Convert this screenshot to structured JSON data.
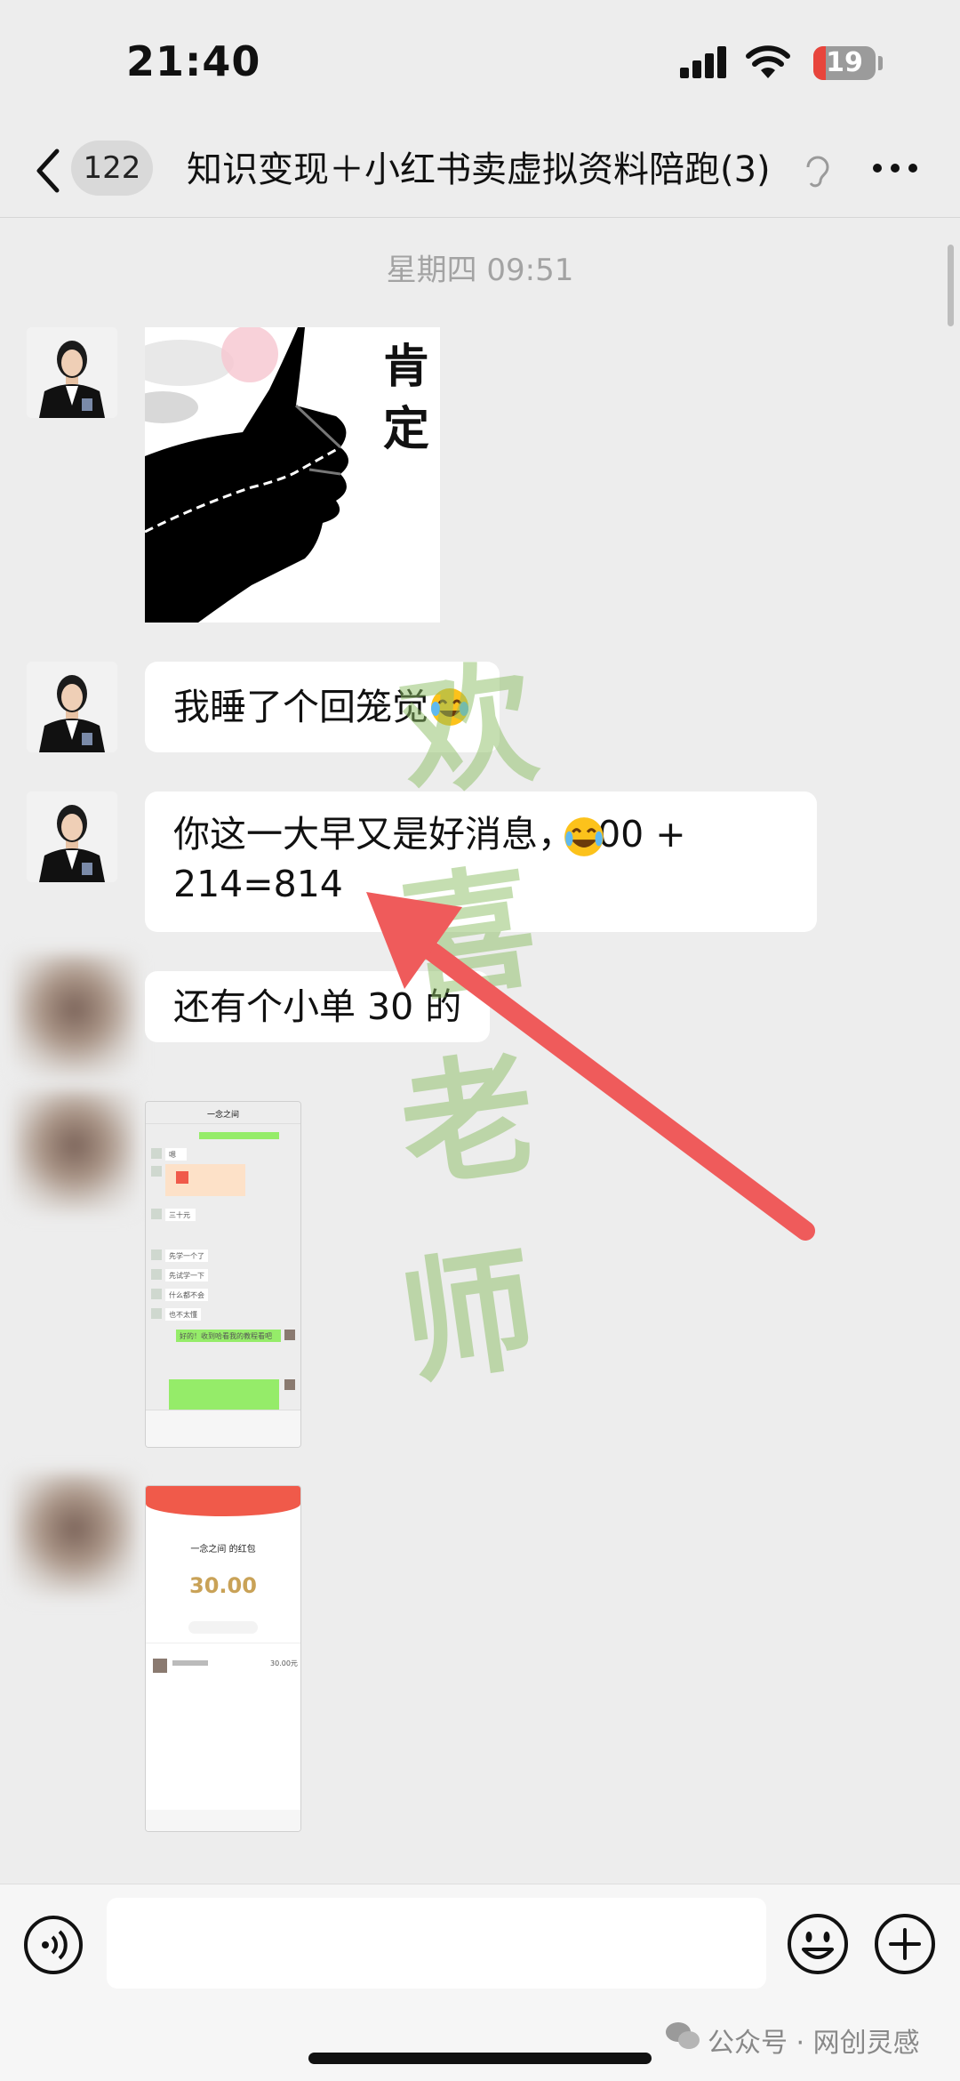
{
  "status_bar": {
    "time": "21:40",
    "battery": "19"
  },
  "nav": {
    "unread_count": "122",
    "title": "知识变现＋小红书卖虚拟资料陪跑(3)"
  },
  "chat": {
    "timestamp": "星期四 09:51",
    "sticker_text": [
      "肯",
      "定"
    ],
    "messages": [
      {
        "text": "我睡了个回笼觉"
      },
      {
        "line1": "你这一大早又是好消息，600 +",
        "line2": "214=814"
      },
      {
        "text": "还有个小单 30 的"
      }
    ],
    "screenshot1": {
      "header": "一念之间",
      "rows": [
        "嗯",
        "三十元",
        "先学一个了",
        "先试学一下",
        "什么都不会",
        "也不太懂",
        "好的！收到哈看我的教程看吧"
      ]
    },
    "screenshot2": {
      "title": "一念之间 的红包",
      "amount": "30.00",
      "list_row": "30.00元"
    }
  },
  "watermark": [
    "欢",
    "喜",
    "老",
    "师"
  ],
  "footer": {
    "text": "公众号 · 网创灵感"
  },
  "colors": {
    "accent_red": "#f05a4a",
    "arrow": "#ef5b5b",
    "wechat_green": "#95ec69"
  }
}
